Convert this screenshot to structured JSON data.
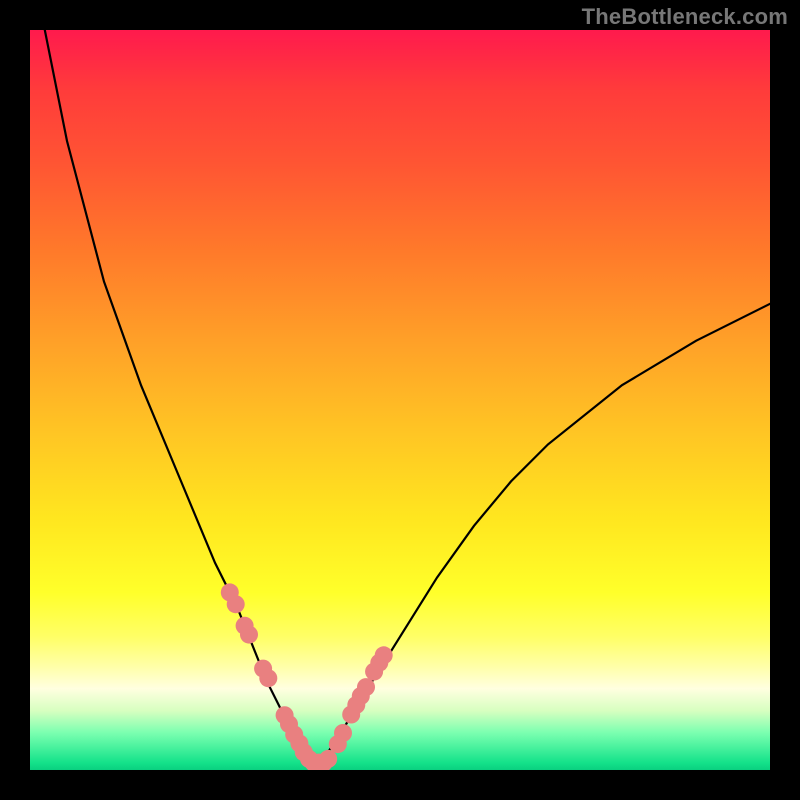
{
  "watermark": "TheBottleneck.com",
  "colors": {
    "curve": "#000000",
    "marker": "#e98080",
    "background_frame": "#000000"
  },
  "chart_data": {
    "type": "line",
    "title": "",
    "xlabel": "",
    "ylabel": "",
    "xlim": [
      0,
      100
    ],
    "ylim": [
      0,
      100
    ],
    "grid": false,
    "legend": false,
    "series": [
      {
        "name": "bottleneck-curve",
        "x": [
          2,
          5,
          10,
          15,
          20,
          25,
          28,
          30,
          32,
          34,
          35,
          36,
          37,
          38,
          39,
          40,
          42,
          45,
          50,
          55,
          60,
          65,
          70,
          80,
          90,
          100
        ],
        "y": [
          100,
          85,
          66,
          52,
          40,
          28,
          22,
          17,
          12,
          8,
          6,
          4,
          2,
          1,
          1,
          2,
          5,
          10,
          18,
          26,
          33,
          39,
          44,
          52,
          58,
          63
        ]
      }
    ],
    "markers": {
      "name": "highlight-dots",
      "x": [
        27.0,
        27.8,
        29.0,
        29.6,
        31.5,
        32.2,
        34.4,
        35.0,
        35.7,
        36.4,
        37.0,
        37.7,
        38.3,
        39.0,
        39.7,
        40.3,
        41.6,
        42.3,
        43.4,
        44.1,
        44.7,
        45.4,
        46.5,
        47.2,
        47.8
      ],
      "y": [
        24.0,
        22.4,
        19.5,
        18.3,
        13.7,
        12.4,
        7.4,
        6.2,
        4.8,
        3.6,
        2.4,
        1.5,
        1.0,
        1.0,
        1.0,
        1.5,
        3.5,
        5.0,
        7.5,
        8.8,
        10.0,
        11.2,
        13.3,
        14.5,
        15.5
      ]
    }
  }
}
